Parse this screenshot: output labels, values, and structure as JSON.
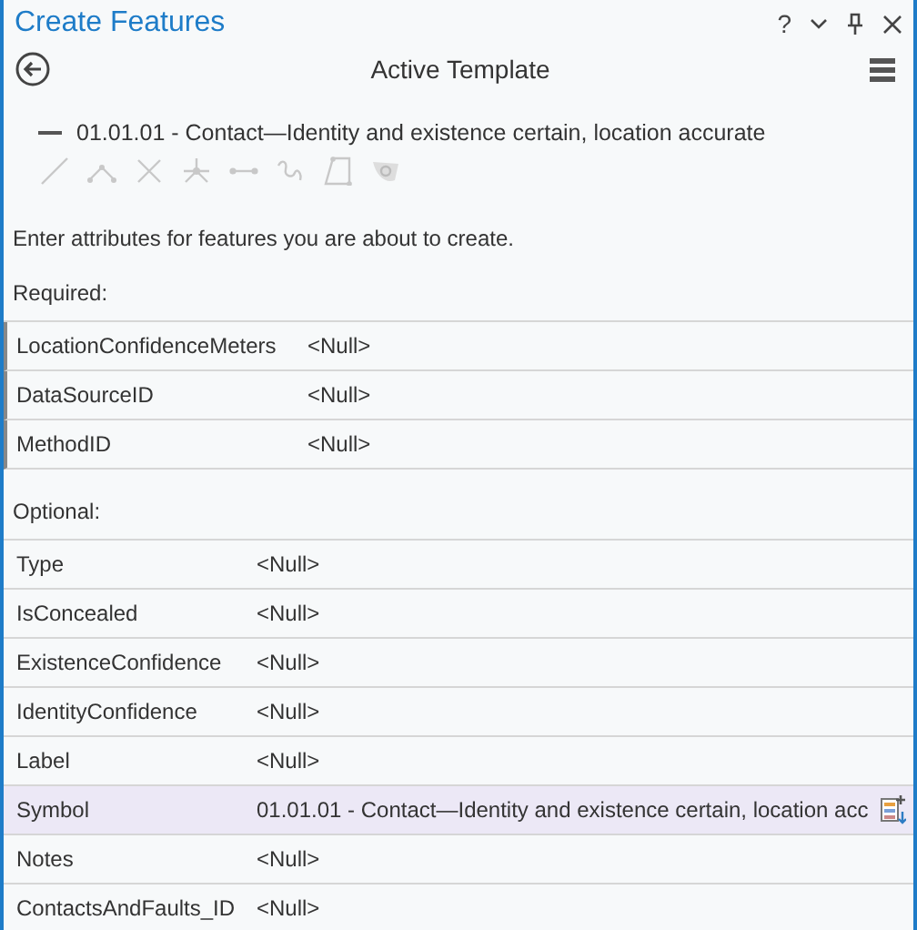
{
  "window": {
    "title": "Create Features",
    "controls": [
      "?"
    ]
  },
  "header": {
    "title": "Active Template"
  },
  "template": {
    "name": "01.01.01 - Contact—Identity and existence certain, location accurate"
  },
  "description": "Enter attributes for features you are about to create.",
  "sections": [
    {
      "title": "Required:",
      "kind": "required",
      "rows": [
        {
          "name": "LocationConfidenceMeters",
          "value": "<Null>",
          "selected": false
        },
        {
          "name": "DataSourceID",
          "value": "<Null>",
          "selected": false
        },
        {
          "name": "MethodID",
          "value": "<Null>",
          "selected": false
        }
      ]
    },
    {
      "title": "Optional:",
      "kind": "optional",
      "rows": [
        {
          "name": "Type",
          "value": "<Null>",
          "selected": false
        },
        {
          "name": "IsConcealed",
          "value": "<Null>",
          "selected": false
        },
        {
          "name": "ExistenceConfidence",
          "value": "<Null>",
          "selected": false
        },
        {
          "name": "IdentityConfidence",
          "value": "<Null>",
          "selected": false
        },
        {
          "name": "Label",
          "value": "<Null>",
          "selected": false
        },
        {
          "name": "Symbol",
          "value": "01.01.01 - Contact—Identity and existence certain, location acc",
          "selected": true
        },
        {
          "name": "Notes",
          "value": "<Null>",
          "selected": false
        },
        {
          "name": "ContactsAndFaults_ID",
          "value": "<Null>",
          "selected": false
        }
      ]
    }
  ]
}
